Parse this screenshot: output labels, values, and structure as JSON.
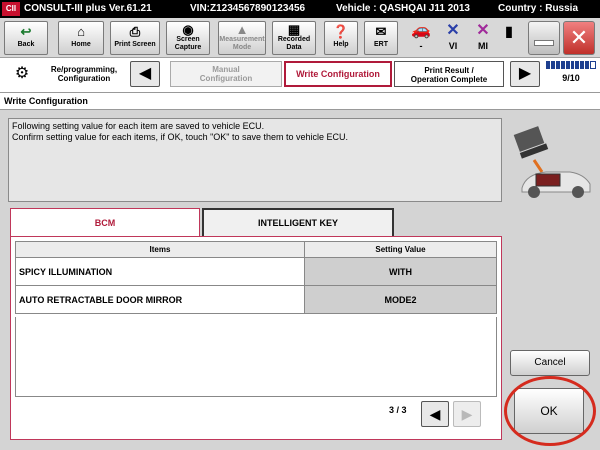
{
  "titlebar": {
    "logo": "CII",
    "app": "CONSULT-III plus  Ver.61.21",
    "vin": "VIN:Z1234567890123456",
    "vehicle": "Vehicle : QASHQAI J11 2013",
    "country": "Country : Russia"
  },
  "toolbar": {
    "back": "Back",
    "home": "Home",
    "print_screen": "Print Screen",
    "screen_capture_1": "Screen",
    "screen_capture_2": "Capture",
    "measurement_1": "Measurement",
    "measurement_2": "Mode",
    "recorded_1": "Recorded",
    "recorded_2": "Data",
    "help": "Help",
    "ert": "ERT",
    "mini_dash": "-",
    "mini_vi": "VI",
    "mini_mi": "MI"
  },
  "nav": {
    "reprog_1": "Re/programming,",
    "reprog_2": "Configuration",
    "manual_1": "Manual",
    "manual_2": "Configuration",
    "write": "Write Configuration",
    "print_1": "Print Result /",
    "print_2": "Operation Complete",
    "progress_text": "9/10",
    "progress_value": 0.9
  },
  "section_label": "Write Configuration",
  "message": {
    "line1": "Following setting value for each item are saved to vehicle ECU.",
    "line2": "Confirm setting value for each items, if OK, touch \"OK\" to save them to vehicle ECU."
  },
  "tabs": {
    "bcm": "BCM",
    "intelligent_key": "INTELLIGENT KEY"
  },
  "table": {
    "headers": [
      "Items",
      "Setting Value"
    ],
    "rows": [
      {
        "item": "SPICY ILLUMINATION",
        "value": "WITH"
      },
      {
        "item": "AUTO RETRACTABLE DOOR MIRROR",
        "value": "MODE2"
      }
    ]
  },
  "pager": {
    "text": "3 / 3"
  },
  "buttons": {
    "cancel": "Cancel",
    "ok": "OK"
  },
  "colors": {
    "accent": "#b01a3a",
    "highlight_ring": "#d52b1e",
    "progress": "#1d3f8f"
  }
}
